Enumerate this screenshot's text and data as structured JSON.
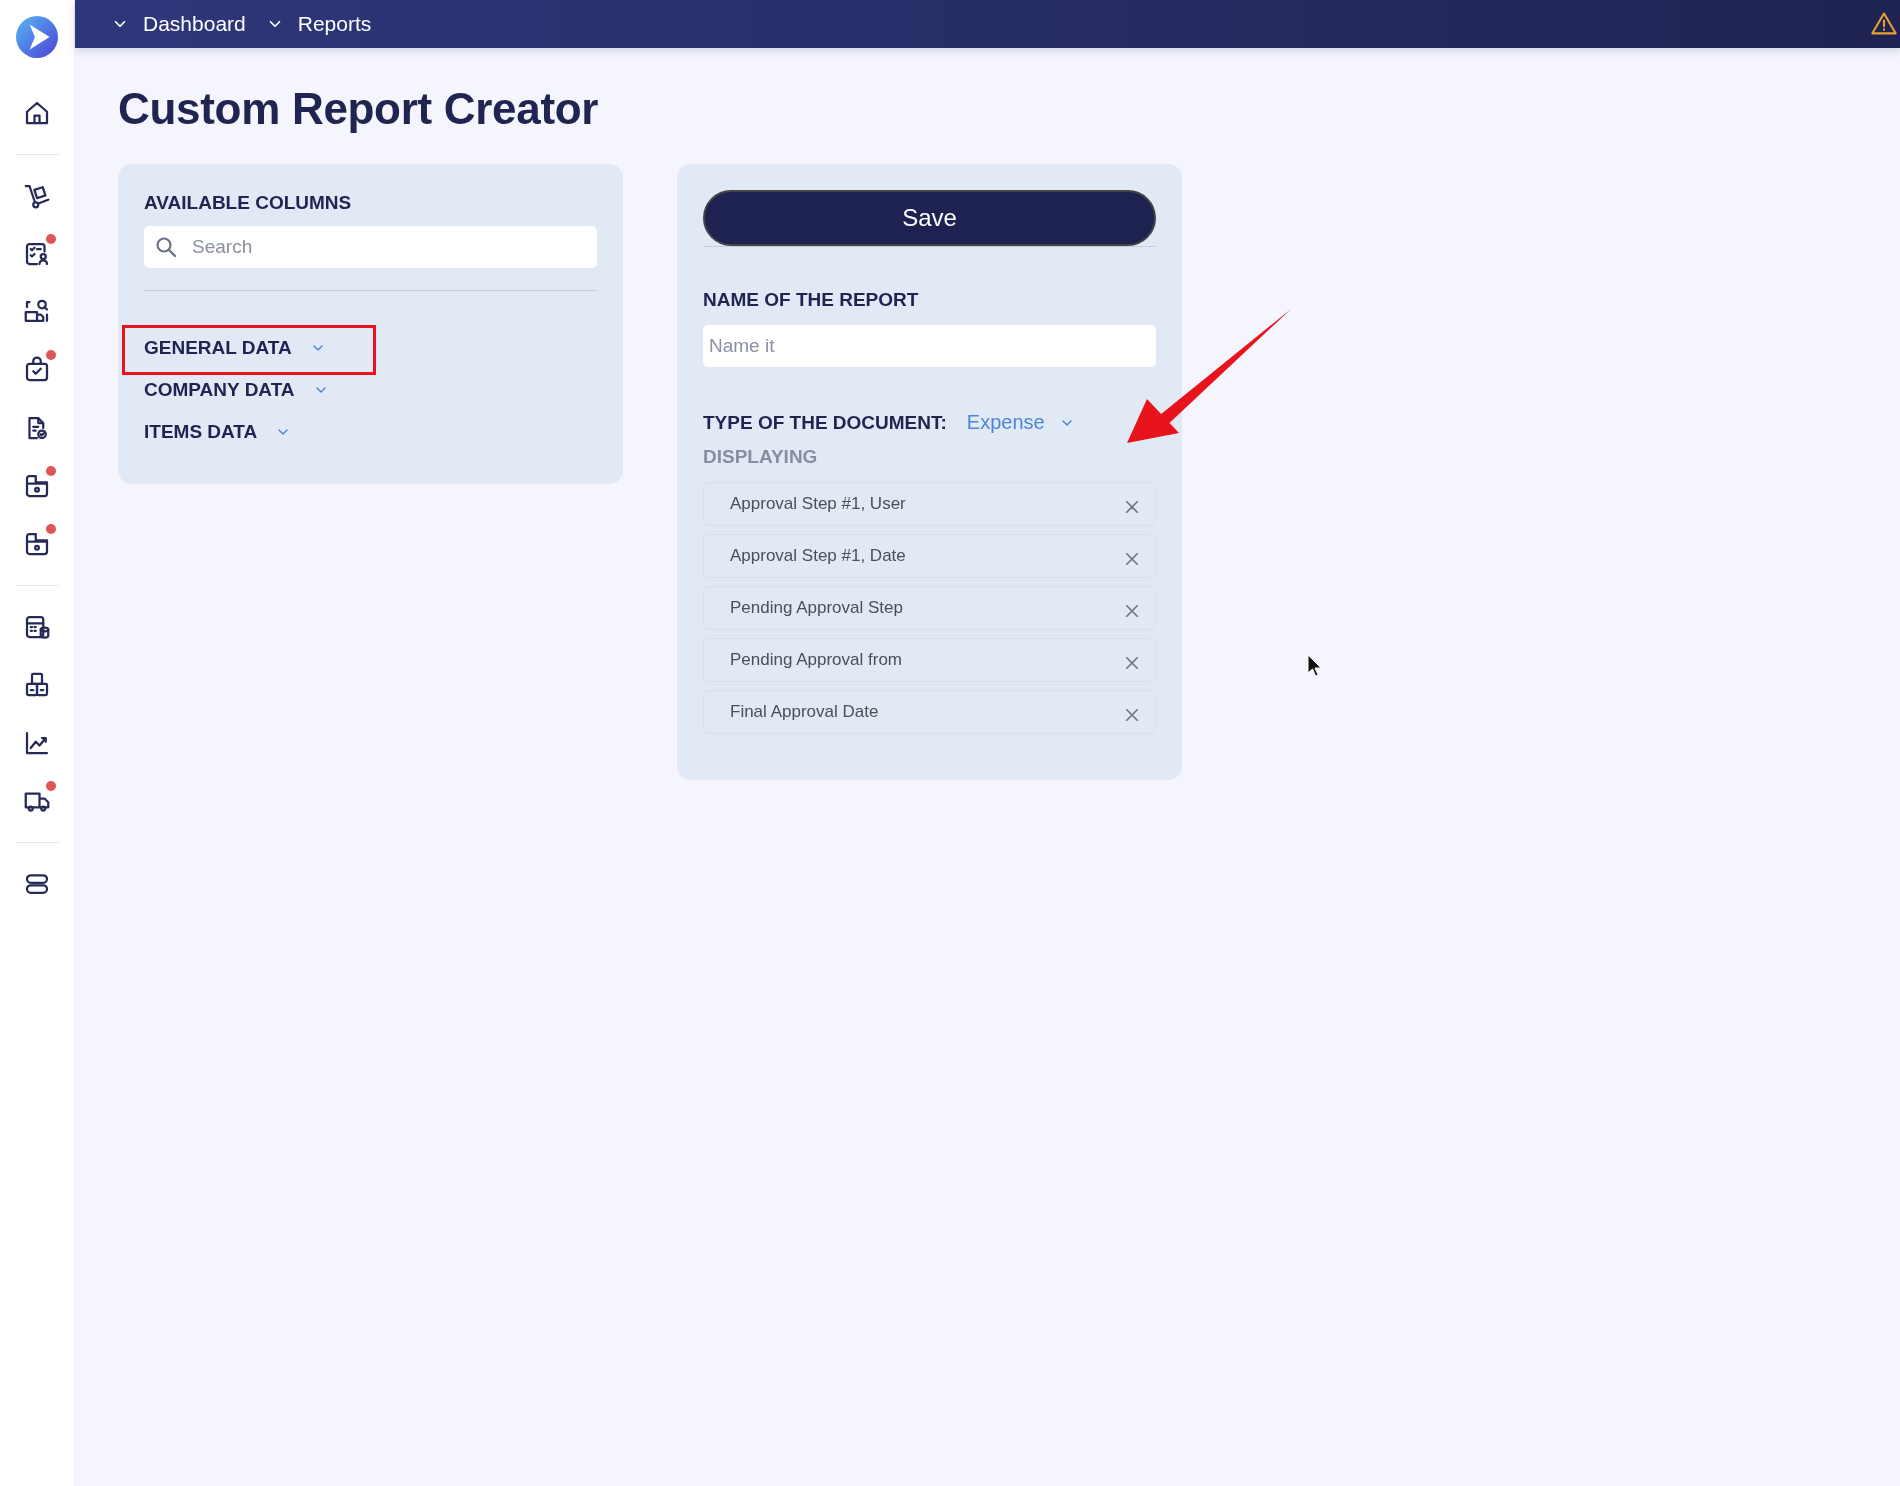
{
  "sidebar": {
    "groups": [
      [
        {
          "kind": "home",
          "badge": false
        }
      ],
      [
        {
          "kind": "cart",
          "badge": false
        },
        {
          "kind": "checklist",
          "badge": true
        },
        {
          "kind": "truck-search",
          "badge": false
        },
        {
          "kind": "bag-check",
          "badge": true
        },
        {
          "kind": "doc-check",
          "badge": false
        },
        {
          "kind": "box-camera",
          "badge": true
        },
        {
          "kind": "box-camera",
          "badge": true
        }
      ],
      [
        {
          "kind": "calculator",
          "badge": false
        },
        {
          "kind": "blocks",
          "badge": false
        },
        {
          "kind": "chart",
          "badge": false
        },
        {
          "kind": "truck",
          "badge": true
        }
      ],
      [
        {
          "kind": "toggles",
          "badge": false
        }
      ]
    ]
  },
  "breadcrumbs": [
    "Dashboard",
    "Reports"
  ],
  "title": "Custom Report Creator",
  "available_columns": {
    "heading": "AVAILABLE COLUMNS",
    "search": {
      "placeholder": "Search"
    },
    "categories": [
      {
        "label": "GENERAL DATA",
        "expanded": false,
        "highlighted": true
      },
      {
        "label": "COMPANY DATA",
        "expanded": false,
        "highlighted": false
      },
      {
        "label": "ITEMS DATA",
        "expanded": false,
        "highlighted": false
      }
    ]
  },
  "report": {
    "save": "Save",
    "name_label": "NAME OF THE REPORT",
    "name": {
      "placeholder": "Name it"
    },
    "type_label": "TYPE OF THE DOCUMENT:",
    "type_value": "Expense",
    "displaying_label": "DISPLAYING",
    "displaying": [
      "Approval Step #1, User",
      "Approval Step #1, Date",
      "Pending Approval Step",
      "Pending Approval from",
      "Final Approval Date"
    ]
  }
}
